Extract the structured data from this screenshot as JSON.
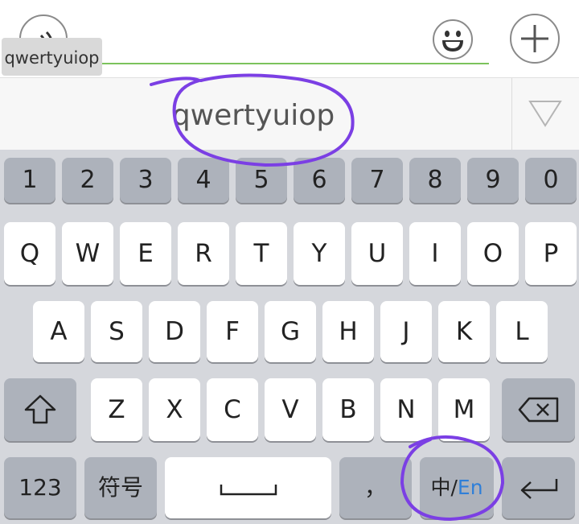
{
  "composer": {
    "typed_text": "qwertyuiop",
    "voice_icon": "voice-wave-icon",
    "emoji_icon": "smiley-face-icon",
    "plus_icon": "plus-icon"
  },
  "candidates": {
    "items": [
      "qwertyuiop"
    ],
    "expand_icon": "triangle-down-icon"
  },
  "keyboard": {
    "number_row": [
      "1",
      "2",
      "3",
      "4",
      "5",
      "6",
      "7",
      "8",
      "9",
      "0"
    ],
    "row1": [
      "Q",
      "W",
      "E",
      "R",
      "T",
      "Y",
      "U",
      "I",
      "O",
      "P"
    ],
    "row2": [
      "A",
      "S",
      "D",
      "F",
      "G",
      "H",
      "J",
      "K",
      "L"
    ],
    "row3": [
      "Z",
      "X",
      "C",
      "V",
      "B",
      "N",
      "M"
    ],
    "shift_icon": "shift-arrow-icon",
    "backspace_icon": "backspace-icon",
    "bottom": {
      "numbers_label": "123",
      "symbols_label": "符号",
      "space_icon": "space-bar-icon",
      "comma_label": "，",
      "lang_zh": "中",
      "lang_sep": "/",
      "lang_en": "En",
      "enter_icon": "return-arrow-icon"
    },
    "colors": {
      "background": "#d5d7dc",
      "char_key": "#ffffff",
      "function_key": "#adb2bb",
      "lang_en_accent": "#2f7fd8",
      "input_underline": "#7cc35c",
      "annotation": "#7b3fe4"
    }
  }
}
